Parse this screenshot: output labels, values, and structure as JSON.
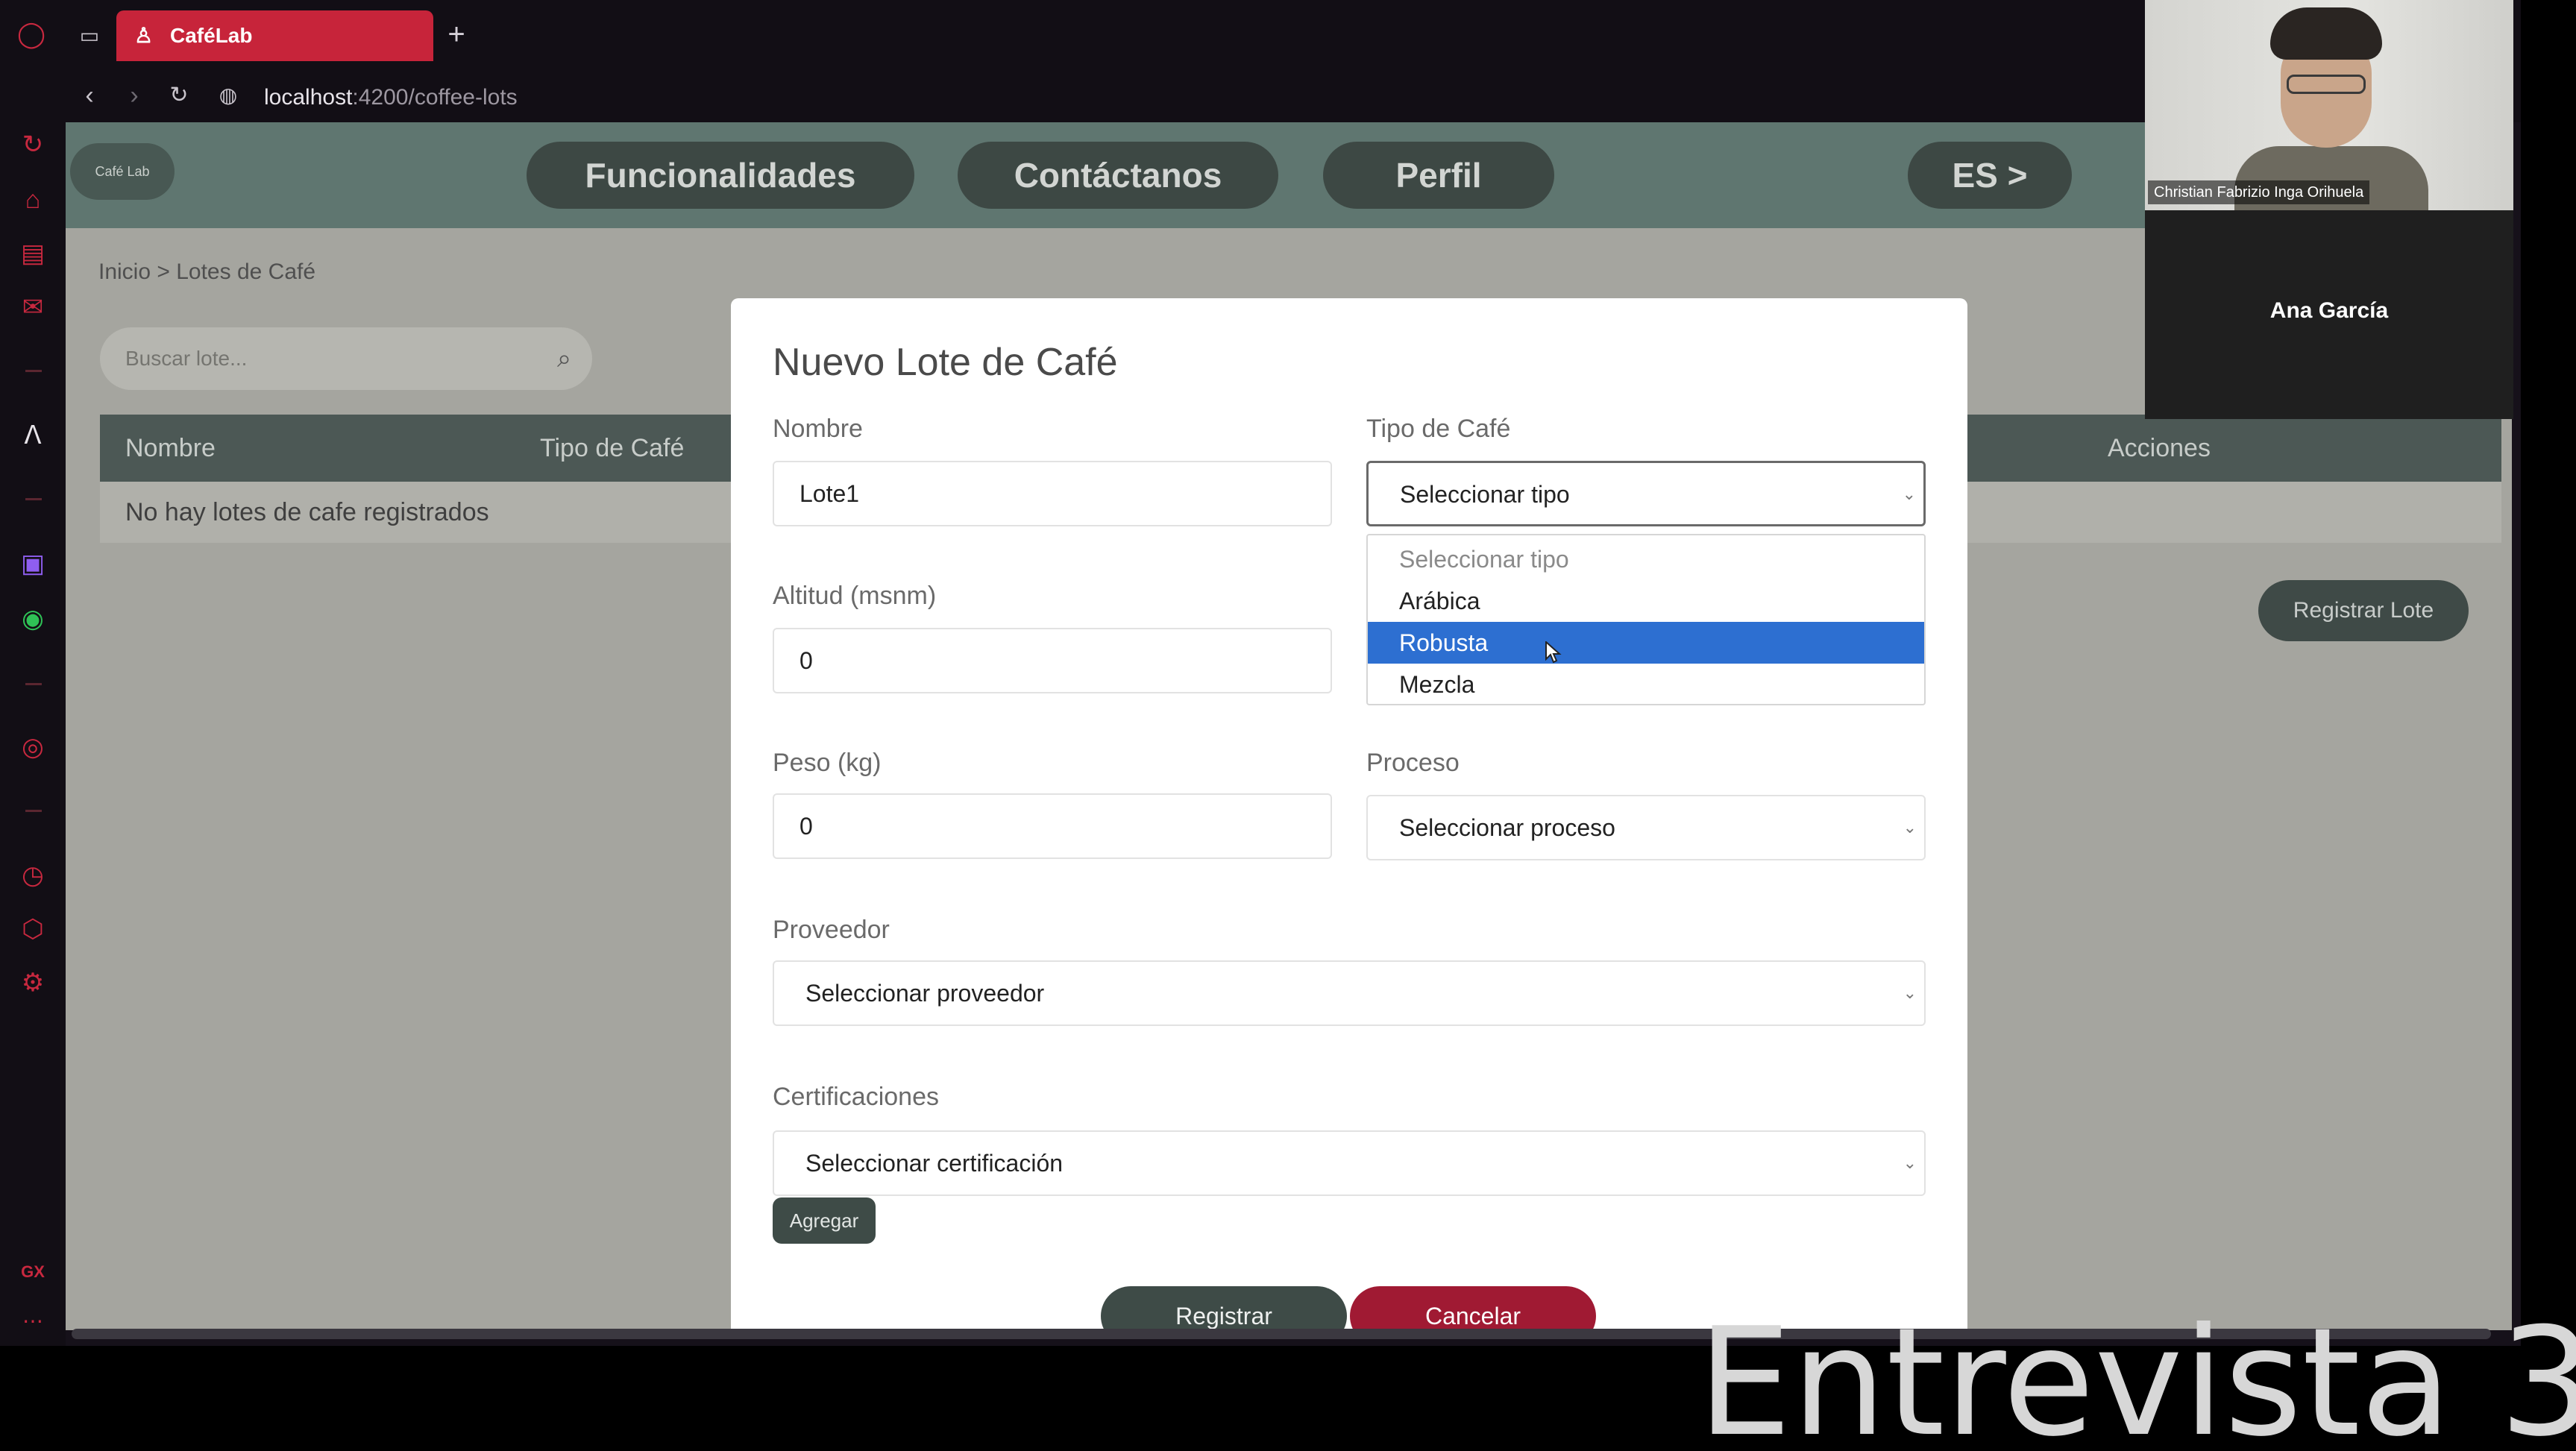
{
  "browser": {
    "tab_title": "CaféLab",
    "new_tab_glyph": "+",
    "url_host": "localhost",
    "url_path": ":4200/coffee-lots",
    "sidebar_bottom_label": "GX"
  },
  "app": {
    "logo_text": "Café Lab",
    "nav": [
      "Funcionalidades",
      "Contáctanos",
      "Perfil"
    ],
    "language": "ES >",
    "breadcrumb": "Inicio > Lotes de Café",
    "search_placeholder": "Buscar lote...",
    "table_headers": [
      "Nombre",
      "Tipo de Café",
      "Acciones"
    ],
    "empty_message": "No hay lotes de cafe registrados",
    "register_button": "Registrar Lote"
  },
  "modal": {
    "title": "Nuevo Lote de Café",
    "nombre_label": "Nombre",
    "nombre_value": "Lote1",
    "tipo_label": "Tipo de Café",
    "tipo_value": "Seleccionar tipo",
    "tipo_options": [
      "Seleccionar tipo",
      "Arábica",
      "Robusta",
      "Mezcla"
    ],
    "tipo_highlighted": "Robusta",
    "altitud_label": "Altitud (msnm)",
    "altitud_value": "0",
    "peso_label": "Peso (kg)",
    "peso_value": "0",
    "proceso_label": "Proceso",
    "proceso_value": "Seleccionar proceso",
    "proveedor_label": "Proveedor",
    "proveedor_value": "Seleccionar proveedor",
    "certificaciones_label": "Certificaciones",
    "certificaciones_value": "Seleccionar certificación",
    "agregar_button": "Agregar",
    "registrar_button": "Registrar",
    "cancelar_button": "Cancelar"
  },
  "video": {
    "self_name": "Christian Fabrizio Inga Orihuela",
    "other_name": "Ana García"
  },
  "caption": "Entrevista 3",
  "colors": {
    "tab_active": "#c7243a",
    "header": "#5f7670",
    "cancel": "#a01a33",
    "highlight": "#2d6fd1"
  }
}
